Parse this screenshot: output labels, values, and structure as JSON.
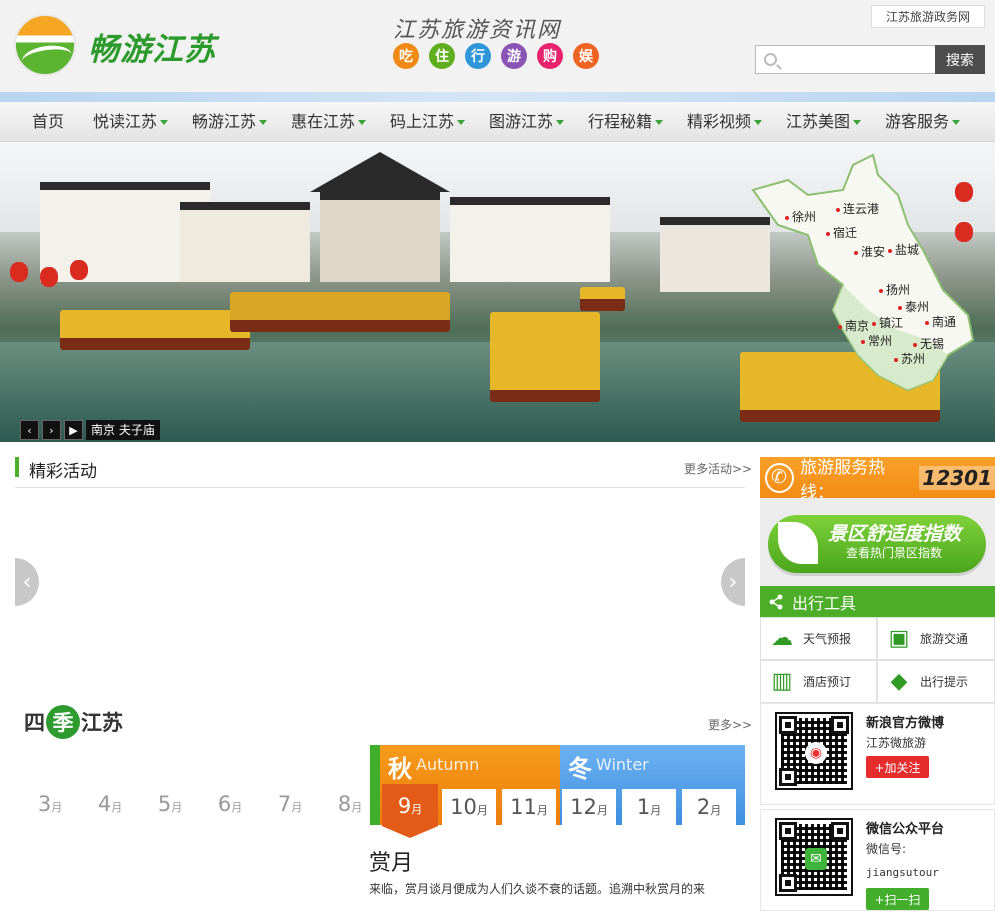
{
  "header": {
    "brand": "畅游江苏",
    "slogan": "江苏旅游资讯网",
    "categories": [
      {
        "label": "吃",
        "color": "#f08a13"
      },
      {
        "label": "住",
        "color": "#5fae1e"
      },
      {
        "label": "行",
        "color": "#2f97d8"
      },
      {
        "label": "游",
        "color": "#8a54b5"
      },
      {
        "label": "购",
        "color": "#e8236e"
      },
      {
        "label": "娱",
        "color": "#f06423"
      }
    ],
    "gov_link": "江苏旅游政务网",
    "search_placeholder": "",
    "search_button": "搜索"
  },
  "nav": {
    "items": [
      {
        "label": "首页"
      },
      {
        "label": "悦读江苏"
      },
      {
        "label": "畅游江苏"
      },
      {
        "label": "惠在江苏"
      },
      {
        "label": "码上江苏"
      },
      {
        "label": "图游江苏"
      },
      {
        "label": "行程秘籍"
      },
      {
        "label": "精彩视频"
      },
      {
        "label": "江苏美图"
      },
      {
        "label": "游客服务"
      }
    ]
  },
  "banner": {
    "caption": "南京 夫子庙",
    "prev": "‹",
    "next": "›",
    "play": "▶",
    "map_cities": [
      "徐州",
      "连云港",
      "宿迁",
      "淮安",
      "盐城",
      "扬州",
      "泰州",
      "南京",
      "镇江",
      "南通",
      "常州",
      "无锡",
      "苏州"
    ]
  },
  "activities": {
    "title": "精彩活动",
    "more": "更多活动>>"
  },
  "seasons": {
    "logo_pre": "四",
    "logo_mid": "季",
    "logo_post": "江苏",
    "more": "更多>>",
    "gray_months": [
      "3",
      "4",
      "5",
      "6",
      "7",
      "8"
    ],
    "autumn": {
      "cn": "秋",
      "en": "Autumn",
      "color": "#f39211"
    },
    "winter": {
      "cn": "冬",
      "en": "Winter",
      "color": "#4e9ae8"
    },
    "active_month": "9",
    "autumn_months": [
      "10",
      "11"
    ],
    "winter_months": [
      "12",
      "1",
      "2"
    ],
    "month_unit": "月",
    "feature_title": "赏月",
    "feature_desc": "来临，赏月谈月便成为人们久谈不衰的话题。追溯中秋赏月的来"
  },
  "sidebar": {
    "hotline_label": "旅游服务热线：",
    "hotline_number": "12301",
    "comfort_title": "景区舒适度指数",
    "comfort_sub": "查看热门景区指数",
    "tools_title": "出行工具",
    "tools": [
      {
        "label": "天气预报",
        "icon": "weather-icon"
      },
      {
        "label": "旅游交通",
        "icon": "bus-icon"
      },
      {
        "label": "酒店预订",
        "icon": "hotel-icon"
      },
      {
        "label": "出行提示",
        "icon": "tag-icon"
      }
    ],
    "weibo": {
      "title": "新浪官方微博",
      "account": "江苏微旅游",
      "button": "+加关注"
    },
    "wechat": {
      "title": "微信公众平台",
      "label": "微信号:",
      "account": "jiangsutour",
      "button": "+扫一扫"
    }
  }
}
